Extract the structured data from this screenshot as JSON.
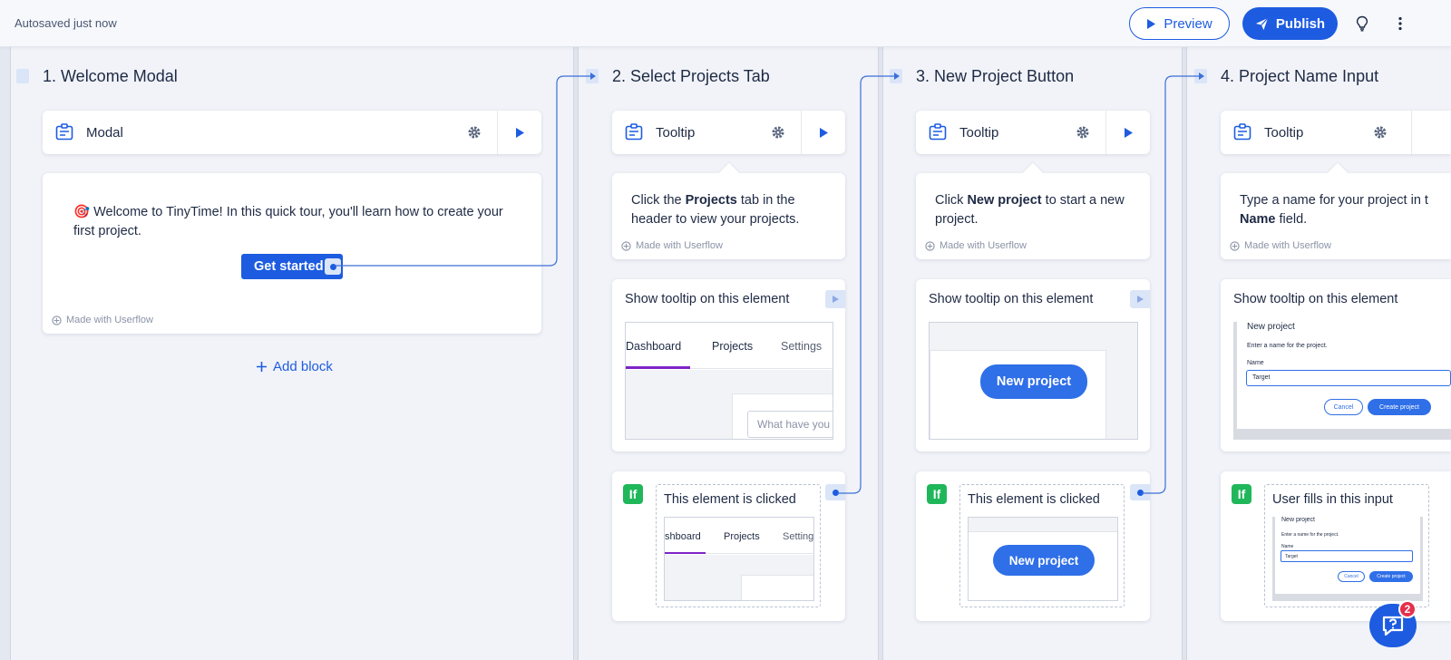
{
  "topbar": {
    "autosave": "Autosaved just now",
    "preview_label": "Preview",
    "publish_label": "Publish"
  },
  "brand_color": "#1d5ce0",
  "made_with": "Made with Userflow",
  "steps": [
    {
      "title": "1.  Welcome Modal",
      "type": "Modal",
      "content": "🎯 Welcome to TinyTime! In this quick tour, you'll learn how to create your first project.",
      "button": "Get started",
      "add_block": "Add block"
    },
    {
      "title": "2.  Select Projects Tab",
      "type": "Tooltip",
      "content_pre": "Click the ",
      "content_bold": "Projects",
      "content_post": " tab in the header to view your projects.",
      "target_title": "Show tooltip on this element",
      "tabs": [
        "Dashboard",
        "Projects",
        "Settings"
      ],
      "input_placeholder": "What have you d",
      "condition": "This element is clicked",
      "cond_tabs": [
        "shboard",
        "Projects",
        "Settings"
      ]
    },
    {
      "title": "3.  New Project Button",
      "type": "Tooltip",
      "content_pre": "Click ",
      "content_bold": "New project",
      "content_post": " to start a new project.",
      "target_title": "Show tooltip on this element",
      "target_button": "New project",
      "condition": "This element is clicked",
      "cond_button": "New project"
    },
    {
      "title": "4.  Project Name Input",
      "type": "Tooltip",
      "content_pre": "Type a name for your project in t",
      "content_bold": "Name",
      "content_post": " field.",
      "target_title": "Show tooltip on this element",
      "dialog_title": "New project",
      "dialog_desc": "Enter a name for the project.",
      "dialog_field_label": "Name",
      "dialog_field_value": "Target",
      "dialog_cancel": "Cancel",
      "dialog_create": "Create project",
      "condition": "User fills in this input"
    }
  ],
  "help_badge_count": "2"
}
